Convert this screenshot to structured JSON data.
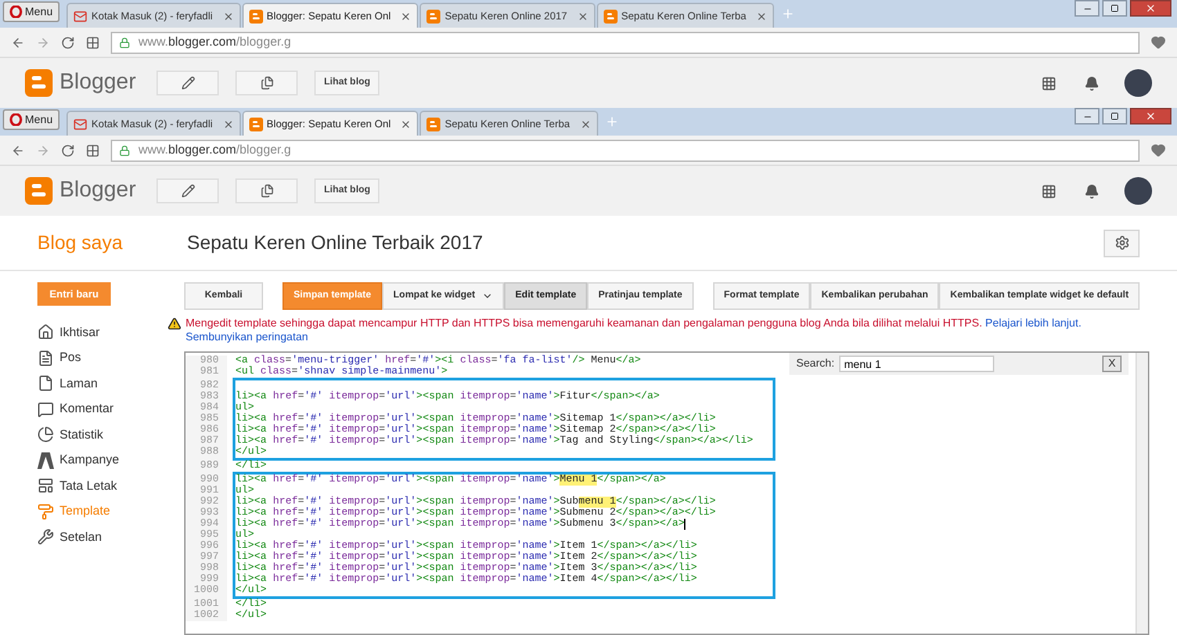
{
  "windows": [
    {
      "menu": "Menu",
      "tabs": [
        {
          "kind": "mail",
          "title": "Kotak Masuk (2) - feryfadli",
          "selected": false
        },
        {
          "kind": "blog",
          "title": "Blogger: Sepatu Keren Onl",
          "selected": true
        },
        {
          "kind": "blog",
          "title": "Sepatu Keren Online 2017",
          "selected": false
        },
        {
          "kind": "blog",
          "title": "Sepatu Keren Online Terba",
          "selected": false
        }
      ],
      "url": {
        "prefix": "www.",
        "domain": "blogger.com",
        "path": "/blogger.g"
      },
      "header": {
        "logo": "Blogger",
        "view_blog": "Lihat blog"
      }
    },
    {
      "menu": "Menu",
      "tabs": [
        {
          "kind": "mail",
          "title": "Kotak Masuk (2) - feryfadli",
          "selected": false
        },
        {
          "kind": "blog",
          "title": "Blogger: Sepatu Keren Onl",
          "selected": true
        },
        {
          "kind": "blog",
          "title": "Sepatu Keren Online Terba",
          "selected": false
        }
      ],
      "url": {
        "prefix": "www.",
        "domain": "blogger.com",
        "path": "/blogger.g"
      },
      "header": {
        "logo": "Blogger",
        "view_blog": "Lihat blog"
      }
    }
  ],
  "blog_header": {
    "my_blogs": "Blog saya",
    "blog_title": "Sepatu Keren Online Terbaik 2017"
  },
  "sidebar": {
    "new_post": "Entri baru",
    "items": [
      {
        "label": "Ikhtisar",
        "selected": false
      },
      {
        "label": "Pos",
        "selected": false
      },
      {
        "label": "Laman",
        "selected": false
      },
      {
        "label": "Komentar",
        "selected": false
      },
      {
        "label": "Statistik",
        "selected": false
      },
      {
        "label": "Kampanye",
        "selected": false
      },
      {
        "label": "Tata Letak",
        "selected": false
      },
      {
        "label": "Template",
        "selected": true
      },
      {
        "label": "Setelan",
        "selected": false
      }
    ]
  },
  "toolbar": {
    "groups": [
      [
        {
          "label": "Kembali",
          "kind": "plain",
          "selected": false
        }
      ],
      [
        {
          "label": "Simpan template",
          "kind": "primary",
          "selected": false
        },
        {
          "label": "Lompat ke widget",
          "kind": "dropdown",
          "selected": false
        },
        {
          "label": "Edit template",
          "kind": "plain",
          "selected": true
        },
        {
          "label": "Pratinjau template",
          "kind": "plain",
          "selected": false
        }
      ],
      [
        {
          "label": "Format template",
          "kind": "plain",
          "selected": false
        },
        {
          "label": "Kembalikan perubahan",
          "kind": "plain",
          "selected": false
        },
        {
          "label": "Kembalikan template widget ke default",
          "kind": "plain",
          "selected": false
        }
      ]
    ]
  },
  "warning": {
    "message": "Mengedit template sehingga dapat mencampur HTTP dan HTTPS bisa memengaruhi keamanan dan pengalaman pengguna blog Anda bila dilihat melalui HTTPS.",
    "link": "Pelajari lebih lanjut.",
    "hide": "Sembunyikan peringatan"
  },
  "editor": {
    "search_label": "Search:",
    "search_value": "menu 1",
    "close": "X",
    "blocks": [
      {
        "boxed": false,
        "lines": [
          {
            "number": "980",
            "cursor": false,
            "segments": [
              {
                "text": "<a class='menu-trigger' href='#'><i class='fa fa-list'/> Menu</a>",
                "highlight": false
              }
            ]
          },
          {
            "number": "981",
            "cursor": false,
            "segments": [
              {
                "text": "<ul class='shnav simple-mainmenu'>",
                "highlight": false
              }
            ]
          }
        ]
      },
      {
        "boxed": true,
        "lines": [
          {
            "number": "982",
            "cursor": false
          },
          {
            "number": "983",
            "cursor": false,
            "segments": [
              {
                "text": "li><a href='#' itemprop='url'><span itemprop='name'>Fitur</span></a>",
                "highlight": false
              }
            ]
          },
          {
            "number": "984",
            "cursor": false,
            "segments": [
              {
                "text": "ul>",
                "highlight": false
              }
            ]
          },
          {
            "number": "985",
            "cursor": false,
            "segments": [
              {
                "text": "li><a href='#' itemprop='url'><span itemprop='name'>Sitemap 1</span></a></li>",
                "highlight": false
              }
            ]
          },
          {
            "number": "986",
            "cursor": false,
            "segments": [
              {
                "text": "li><a href='#' itemprop='url'><span itemprop='name'>Sitemap 2</span></a></li>",
                "highlight": false
              }
            ]
          },
          {
            "number": "987",
            "cursor": false,
            "segments": [
              {
                "text": "li><a href='#' itemprop='url'><span itemprop='name'>Tag and Styling</span></a></li>",
                "highlight": false
              }
            ]
          },
          {
            "number": "988",
            "cursor": false,
            "segments": [
              {
                "text": "</ul>",
                "highlight": false
              }
            ]
          }
        ]
      },
      {
        "boxed": false,
        "lines": [
          {
            "number": "989",
            "cursor": false,
            "segments": [
              {
                "text": "</li>",
                "highlight": false
              }
            ]
          }
        ]
      },
      {
        "boxed": true,
        "lines": [
          {
            "number": "990",
            "cursor": false,
            "segments": [
              {
                "text": "li><a href='#' itemprop='url'><span itemprop='name'>",
                "highlight": false
              },
              {
                "text": "Menu 1",
                "highlight": true
              },
              {
                "text": "</span></a>",
                "highlight": false
              }
            ]
          },
          {
            "number": "991",
            "cursor": false,
            "segments": [
              {
                "text": "ul>",
                "highlight": false
              }
            ]
          },
          {
            "number": "992",
            "cursor": false,
            "segments": [
              {
                "text": "li><a href='#' itemprop='url'><span itemprop='name'>Sub",
                "highlight": false
              },
              {
                "text": "menu 1",
                "highlight": true
              },
              {
                "text": "</span></a></li>",
                "highlight": false
              }
            ]
          },
          {
            "number": "993",
            "cursor": false,
            "segments": [
              {
                "text": "li><a href='#' itemprop='url'><span itemprop='name'>Submenu 2</span></a></li>",
                "highlight": false
              }
            ]
          },
          {
            "number": "994",
            "cursor": true,
            "segments": [
              {
                "text": "li><a href='#' itemprop='url'><span itemprop='name'>Submenu 3</span></a>",
                "highlight": false
              }
            ]
          },
          {
            "number": "995",
            "cursor": false,
            "segments": [
              {
                "text": "ul>",
                "highlight": false
              }
            ]
          },
          {
            "number": "996",
            "cursor": false,
            "segments": [
              {
                "text": "li><a href='#' itemprop='url'><span itemprop='name'>Item 1</span></a></li>",
                "highlight": false
              }
            ]
          },
          {
            "number": "997",
            "cursor": false,
            "segments": [
              {
                "text": "li><a href='#' itemprop='url'><span itemprop='name'>Item 2</span></a></li>",
                "highlight": false
              }
            ]
          },
          {
            "number": "998",
            "cursor": false,
            "segments": [
              {
                "text": "li><a href='#' itemprop='url'><span itemprop='name'>Item 3</span></a></li>",
                "highlight": false
              }
            ]
          },
          {
            "number": "999",
            "cursor": false,
            "segments": [
              {
                "text": "li><a href='#' itemprop='url'><span itemprop='name'>Item 4</span></a></li>",
                "highlight": false
              }
            ]
          },
          {
            "number": "1000",
            "cursor": false,
            "segments": [
              {
                "text": "</ul>",
                "highlight": false
              }
            ]
          }
        ]
      },
      {
        "boxed": false,
        "lines": [
          {
            "number": "1001",
            "cursor": false,
            "segments": [
              {
                "text": "</li>",
                "highlight": false
              }
            ]
          },
          {
            "number": "1002",
            "cursor": false,
            "segments": [
              {
                "text": "</ul>",
                "highlight": false
              }
            ]
          }
        ]
      }
    ]
  }
}
